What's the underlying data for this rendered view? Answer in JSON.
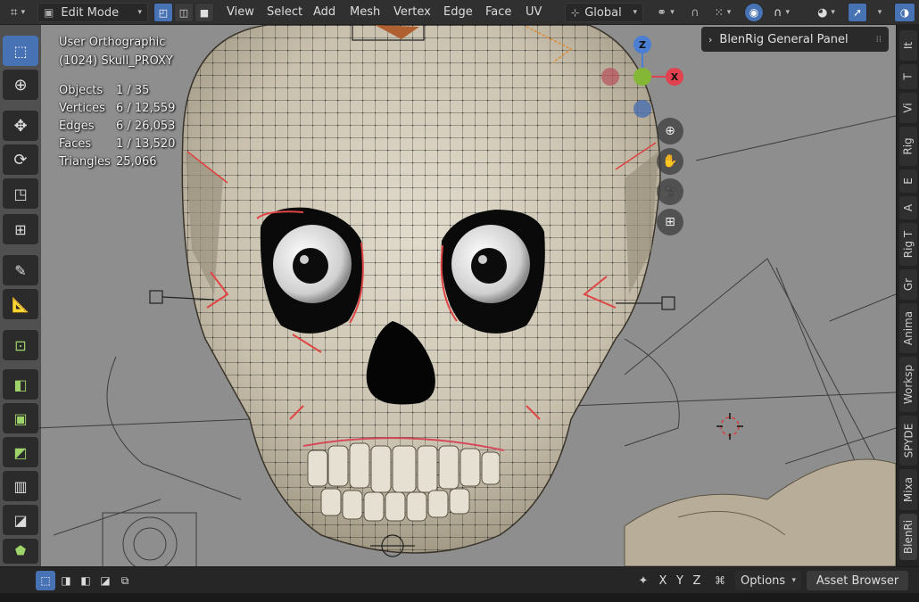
{
  "header": {
    "mode": "Edit Mode",
    "menus": [
      "View",
      "Select",
      "Add",
      "Mesh",
      "Vertex",
      "Edge",
      "Face",
      "UV"
    ],
    "orientation": "Global"
  },
  "viewport_info": {
    "view_name": "User Orthographic",
    "object_name": "(1024) Skull_PROXY",
    "stats": [
      {
        "label": "Objects",
        "value": "1 / 35"
      },
      {
        "label": "Vertices",
        "value": "6 / 12,559"
      },
      {
        "label": "Edges",
        "value": "6 / 26,053"
      },
      {
        "label": "Faces",
        "value": "1 / 13,520"
      },
      {
        "label": "Triangles",
        "value": "25,066"
      }
    ]
  },
  "gizmo": {
    "z": "Z",
    "x": "X"
  },
  "panel": {
    "title": "BlenRig General Panel"
  },
  "side_tabs": [
    "It",
    "T",
    "Vi",
    "Rig",
    "E",
    "A",
    "Rig T",
    "Gr",
    "Anima",
    "Worksp",
    "SPYDE",
    "Mixa",
    "BlenRi"
  ],
  "bottom": {
    "axes": [
      "X",
      "Y",
      "Z"
    ],
    "options_label": "Options",
    "asset_browser": "Asset Browser"
  },
  "colors": {
    "accent": "#4772b3",
    "x_axis": "#e0434f",
    "y_axis": "#83b735",
    "z_axis": "#4a7fd4"
  }
}
